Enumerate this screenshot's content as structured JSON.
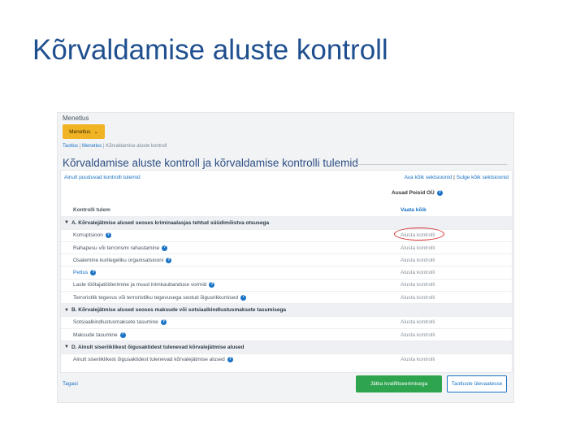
{
  "slide": {
    "title": "Kõrvaldamise aluste kontroll"
  },
  "app": {
    "menu_label": "Menetlus",
    "menu_button": "Menetlus",
    "breadcrumb": [
      "Taotlus",
      "Menetlus",
      "Kõrvaldamise aluste kontroll"
    ],
    "page_title": "Kõrvaldamise aluste kontroll ja kõrvaldamise kontrolli tulemid",
    "filter_link": "Ainult puuduvad kontrolli tulemid",
    "expand_all": "Ava kõik sektsioonid",
    "collapse_all": "Sulge kõik sektsioonid",
    "company": "Ausad Poisid OÜ",
    "column_header": "Kontrolli tulem",
    "column_action": "Vaata kõik",
    "rows": [
      {
        "type": "section",
        "label": "A. Kõrvalejätmise alused seoses kriminaalasjas tehtud süüdimõistva otsusega"
      },
      {
        "type": "item",
        "label": "Korruptsioon",
        "value": "Alusta kontrolli",
        "highlight": true
      },
      {
        "type": "item",
        "label": "Rahapesu või terrorismi rahastamine",
        "value": "Alusta kontrolli"
      },
      {
        "type": "item",
        "label": "Osalemine kuritegeliku organisatsiooni",
        "value": "Alusta kontrolli"
      },
      {
        "type": "item",
        "label": "Pettus",
        "value": "Alusta kontrolli",
        "blue": true
      },
      {
        "type": "item",
        "label": "Laste töötajatöölerimine ja muud inimkaubanduse vormid",
        "value": "Alusta kontrolli"
      },
      {
        "type": "item",
        "label": "Terroristlik tegevus või terroristliku tegevusega seotud õigusrikkumised",
        "value": "Alusta kontrolli"
      },
      {
        "type": "section",
        "label": "B. Kõrvalejätmise alused seoses maksude või sotsiaalkindlustusmaksete tasumisega"
      },
      {
        "type": "item",
        "label": "Sotsiaalkindlustusmaksete tasumine",
        "value": "Alusta kontrolli"
      },
      {
        "type": "item",
        "label": "Maksude tasumine",
        "value": "Alusta kontrolli"
      },
      {
        "type": "section",
        "label": "D. Ainult siseriiklikest õigusaktidest tulenevad kõrvalejätmise alused"
      },
      {
        "type": "item",
        "label": "Ainult siseriiklikest õigusaktidest tulenevad kõrvalejätmise alused",
        "value": "Alusta kontrolli"
      }
    ],
    "back": "Tagasi",
    "primary_button": "Jätka kvalifitseerimisega",
    "secondary_button": "Taotluste ülevaatesse"
  },
  "colors": {
    "title": "#1f4f8f",
    "accent": "#f0b323",
    "link": "#1a73c5",
    "success": "#2ea44f",
    "highlight": "#d62b2b"
  },
  "icons": {
    "help": "question-circle-icon",
    "expand": "chevron-down-icon"
  }
}
